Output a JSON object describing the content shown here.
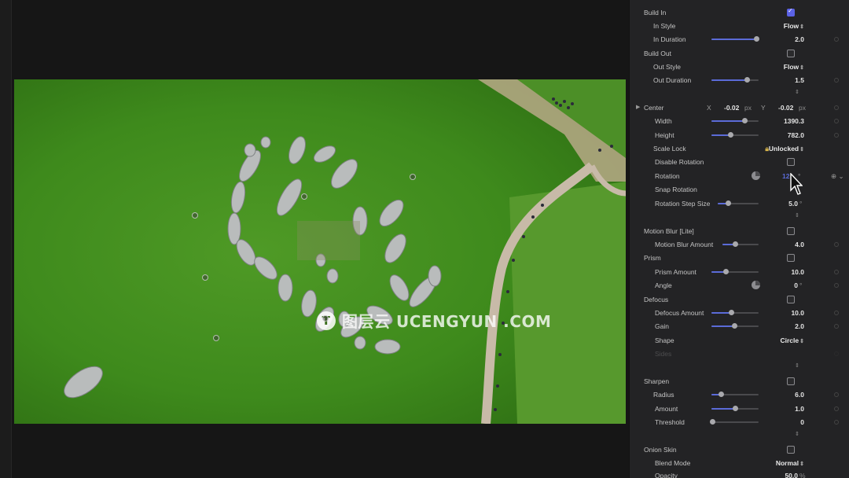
{
  "viewer": {
    "watermark_text": "图层云 UCENGYUN .COM",
    "watermark_logo": "T"
  },
  "inspector": {
    "build_in": {
      "label": "Build In",
      "checked": true
    },
    "in_style": {
      "label": "In Style",
      "value": "Flow"
    },
    "in_duration": {
      "label": "In Duration",
      "value": "2.0",
      "level": 0.95
    },
    "build_out": {
      "label": "Build Out",
      "checked": false
    },
    "out_style": {
      "label": "Out Style",
      "value": "Flow"
    },
    "out_duration": {
      "label": "Out Duration",
      "value": "1.5",
      "level": 0.75
    },
    "center": {
      "label": "Center",
      "x_label": "X",
      "x_value": "-0.02",
      "y_label": "Y",
      "y_value": "-0.02",
      "unit": "px"
    },
    "width": {
      "label": "Width",
      "value": "1390.3",
      "level": 0.7
    },
    "height": {
      "label": "Height",
      "value": "782.0",
      "level": 0.4
    },
    "scale_lock": {
      "label": "Scale Lock",
      "value": "Unlocked"
    },
    "disable_rotation": {
      "label": "Disable Rotation",
      "checked": false
    },
    "rotation": {
      "label": "Rotation",
      "value": "12",
      "unit": "°"
    },
    "snap_rotation": {
      "label": "Snap Rotation"
    },
    "rotation_step_size": {
      "label": "Rotation Step Size",
      "value": "5.0",
      "unit": "°",
      "level": 0.25
    },
    "motion_blur": {
      "label": "Motion Blur [Lite]",
      "checked": false
    },
    "motion_blur_amount": {
      "label": "Motion Blur Amount",
      "value": "4.0",
      "level": 0.35
    },
    "prism": {
      "label": "Prism",
      "checked": false
    },
    "prism_amount": {
      "label": "Prism Amount",
      "value": "10.0",
      "level": 0.3
    },
    "angle": {
      "label": "Angle",
      "value": "0",
      "unit": "°"
    },
    "defocus": {
      "label": "Defocus",
      "checked": false
    },
    "defocus_amount": {
      "label": "Defocus Amount",
      "value": "10.0",
      "level": 0.42
    },
    "gain": {
      "label": "Gain",
      "value": "2.0",
      "level": 0.48
    },
    "shape": {
      "label": "Shape",
      "value": "Circle"
    },
    "sides": {
      "label": "Sides"
    },
    "sharpen": {
      "label": "Sharpen",
      "checked": false
    },
    "radius": {
      "label": "Radius",
      "value": "6.0",
      "level": 0.2
    },
    "amount": {
      "label": "Amount",
      "value": "1.0",
      "level": 0.5
    },
    "threshold": {
      "label": "Threshold",
      "value": "0",
      "level": 0.02
    },
    "onion_skin": {
      "label": "Onion Skin",
      "checked": false
    },
    "blend_mode": {
      "label": "Blend Mode",
      "value": "Normal"
    },
    "opacity": {
      "label": "Opacity",
      "value": "50.0",
      "unit": "%"
    }
  },
  "colors": {
    "accent": "#5b62e6",
    "panel": "#232325",
    "grass": "#3f8a1c"
  },
  "icons": [
    "lock-icon",
    "disclosure-triangle-icon",
    "stepper-icon",
    "dial-icon",
    "mouse-pointer-icon",
    "keyframe-diamond-icon"
  ]
}
